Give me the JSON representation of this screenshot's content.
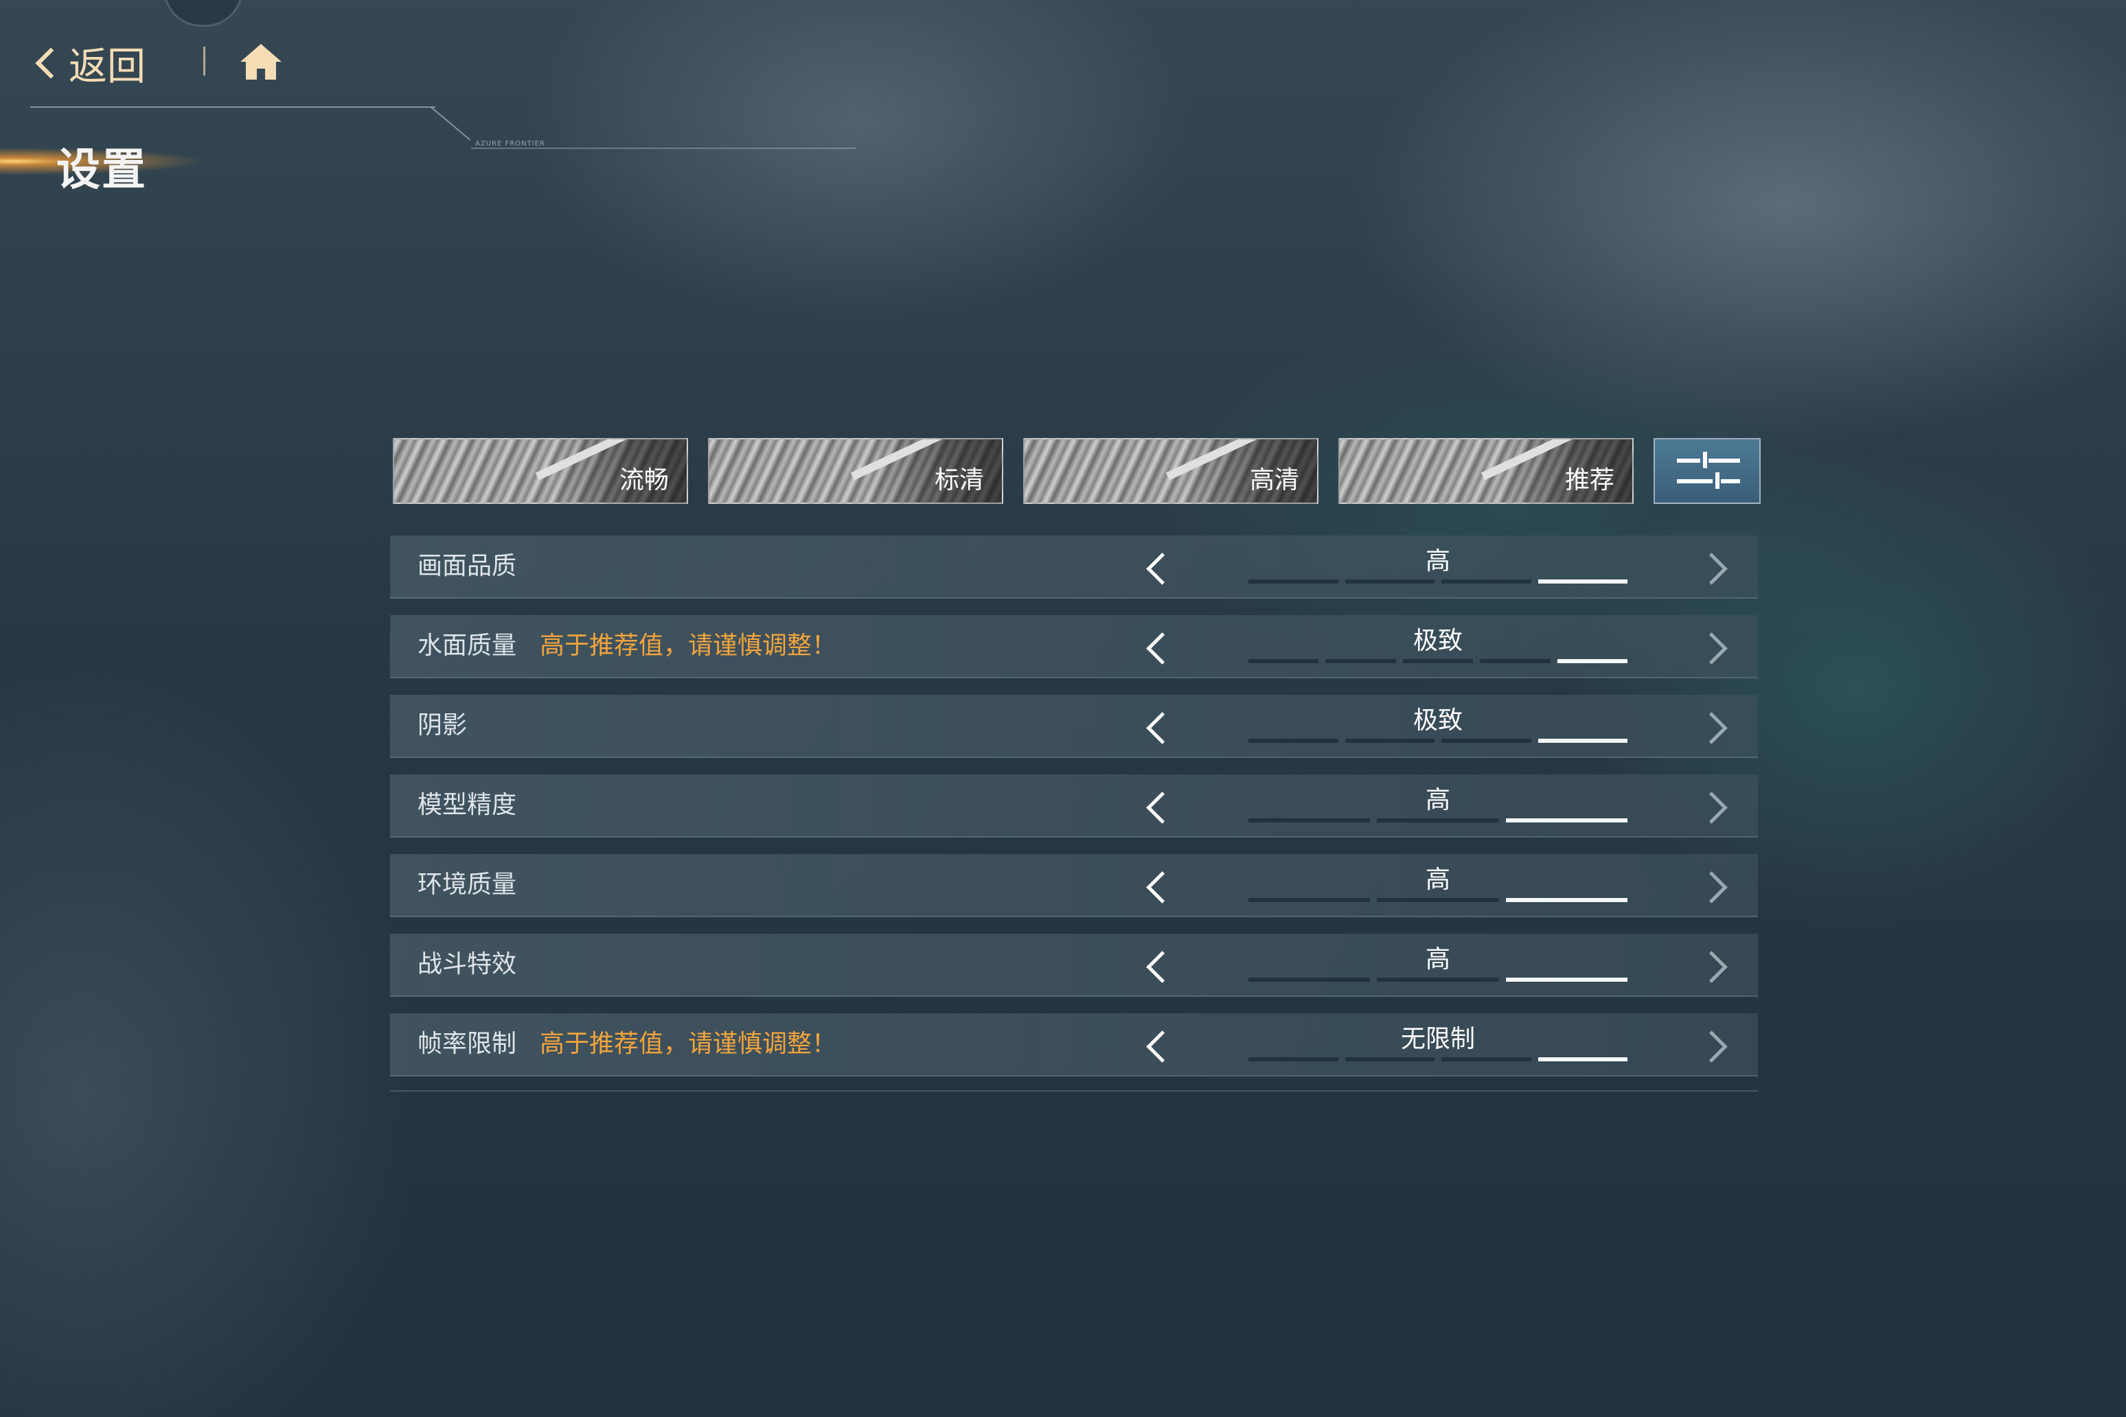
{
  "nav": {
    "back_label": "返回",
    "home_icon": "home-icon",
    "title": "设置",
    "brand": "AZURE FRONTIER"
  },
  "presets": [
    {
      "label": "流畅"
    },
    {
      "label": "标清"
    },
    {
      "label": "高清"
    },
    {
      "label": "推荐"
    }
  ],
  "custom_preset_icon": "sliders-icon",
  "settings": [
    {
      "label": "画面品质",
      "warning": "",
      "value": "高",
      "level": 4,
      "levels": 4
    },
    {
      "label": "水面质量",
      "warning": "高于推荐值，请谨慎调整！",
      "value": "极致",
      "level": 5,
      "levels": 5
    },
    {
      "label": "阴影",
      "warning": "",
      "value": "极致",
      "level": 4,
      "levels": 4
    },
    {
      "label": "模型精度",
      "warning": "",
      "value": "高",
      "level": 3,
      "levels": 3
    },
    {
      "label": "环境质量",
      "warning": "",
      "value": "高",
      "level": 3,
      "levels": 3
    },
    {
      "label": "战斗特效",
      "warning": "",
      "value": "高",
      "level": 3,
      "levels": 3
    },
    {
      "label": "帧率限制",
      "warning": "高于推荐值，请谨慎调整！",
      "value": "无限制",
      "level": 4,
      "levels": 4
    }
  ],
  "colors": {
    "accent_gold": "#f4dcb4",
    "warning": "#f4a43a",
    "active_segment": "#f4f6f8"
  }
}
